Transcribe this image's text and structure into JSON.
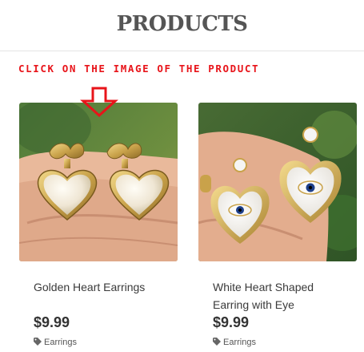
{
  "header": {
    "title": "PRODUCTS"
  },
  "instruction": {
    "text": "CLICK ON THE IMAGE OF THE PRODUCT",
    "color": "#e8141a"
  },
  "products": [
    {
      "name": "Golden Heart Earrings",
      "price": "$9.99",
      "category": "Earrings",
      "image_icon": "pearl-heart-earrings-photo"
    },
    {
      "name": "White Heart Shaped Earring with Eye",
      "price": "$9.99",
      "category": "Earrings",
      "image_icon": "evil-eye-heart-earrings-photo"
    }
  ]
}
